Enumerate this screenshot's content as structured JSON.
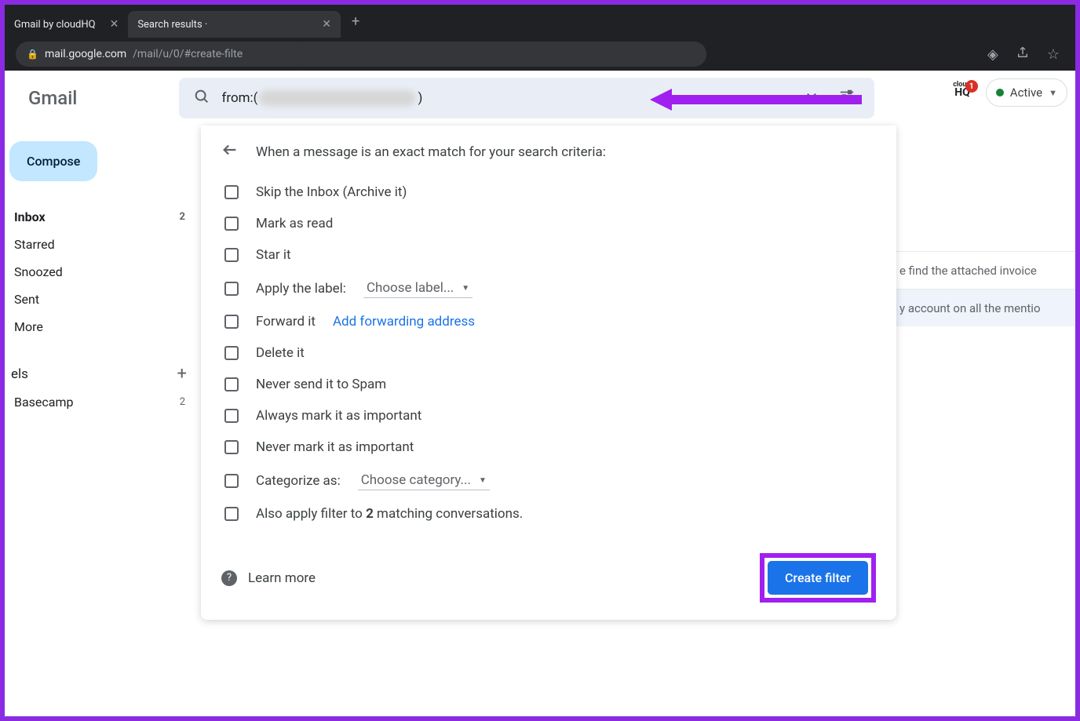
{
  "browser": {
    "tabs": [
      {
        "title": "Gmail by cloudHQ",
        "active": false
      },
      {
        "title": "Search results ·",
        "active": true
      }
    ],
    "url_host": "mail.google.com",
    "url_path": "/mail/u/0/#create-filte"
  },
  "gmail": {
    "logo": "Gmail",
    "search": {
      "prefix": "from:(",
      "suffix": ")"
    },
    "cloudhq_badge": "1",
    "active_label": "Active",
    "compose": "Compose",
    "nav": [
      {
        "label": "Inbox",
        "count": "2",
        "bold": true
      },
      {
        "label": "Starred",
        "count": "",
        "bold": false
      },
      {
        "label": "Snoozed",
        "count": "",
        "bold": false
      },
      {
        "label": "Sent",
        "count": "",
        "bold": false
      },
      {
        "label": "More",
        "count": "",
        "bold": false
      }
    ],
    "labels_header": "els",
    "labels": [
      {
        "label": "Basecamp",
        "count": "2"
      }
    ],
    "peek_rows": [
      "e find the attached invoice",
      "y account on all the mentio"
    ]
  },
  "filter_panel": {
    "header": "When a message is an exact match for your search criteria:",
    "options": {
      "skip_inbox": "Skip the Inbox (Archive it)",
      "mark_read": "Mark as read",
      "star": "Star it",
      "apply_label": "Apply the label:",
      "apply_label_choose": "Choose label...",
      "forward": "Forward it",
      "forward_link": "Add forwarding address",
      "delete": "Delete it",
      "never_spam": "Never send it to Spam",
      "always_important": "Always mark it as important",
      "never_important": "Never mark it as important",
      "categorize": "Categorize as:",
      "categorize_choose": "Choose category...",
      "also_apply_pre": "Also apply filter to ",
      "also_apply_count": "2",
      "also_apply_post": " matching conversations."
    },
    "learn_more": "Learn more",
    "create_filter": "Create filter"
  }
}
